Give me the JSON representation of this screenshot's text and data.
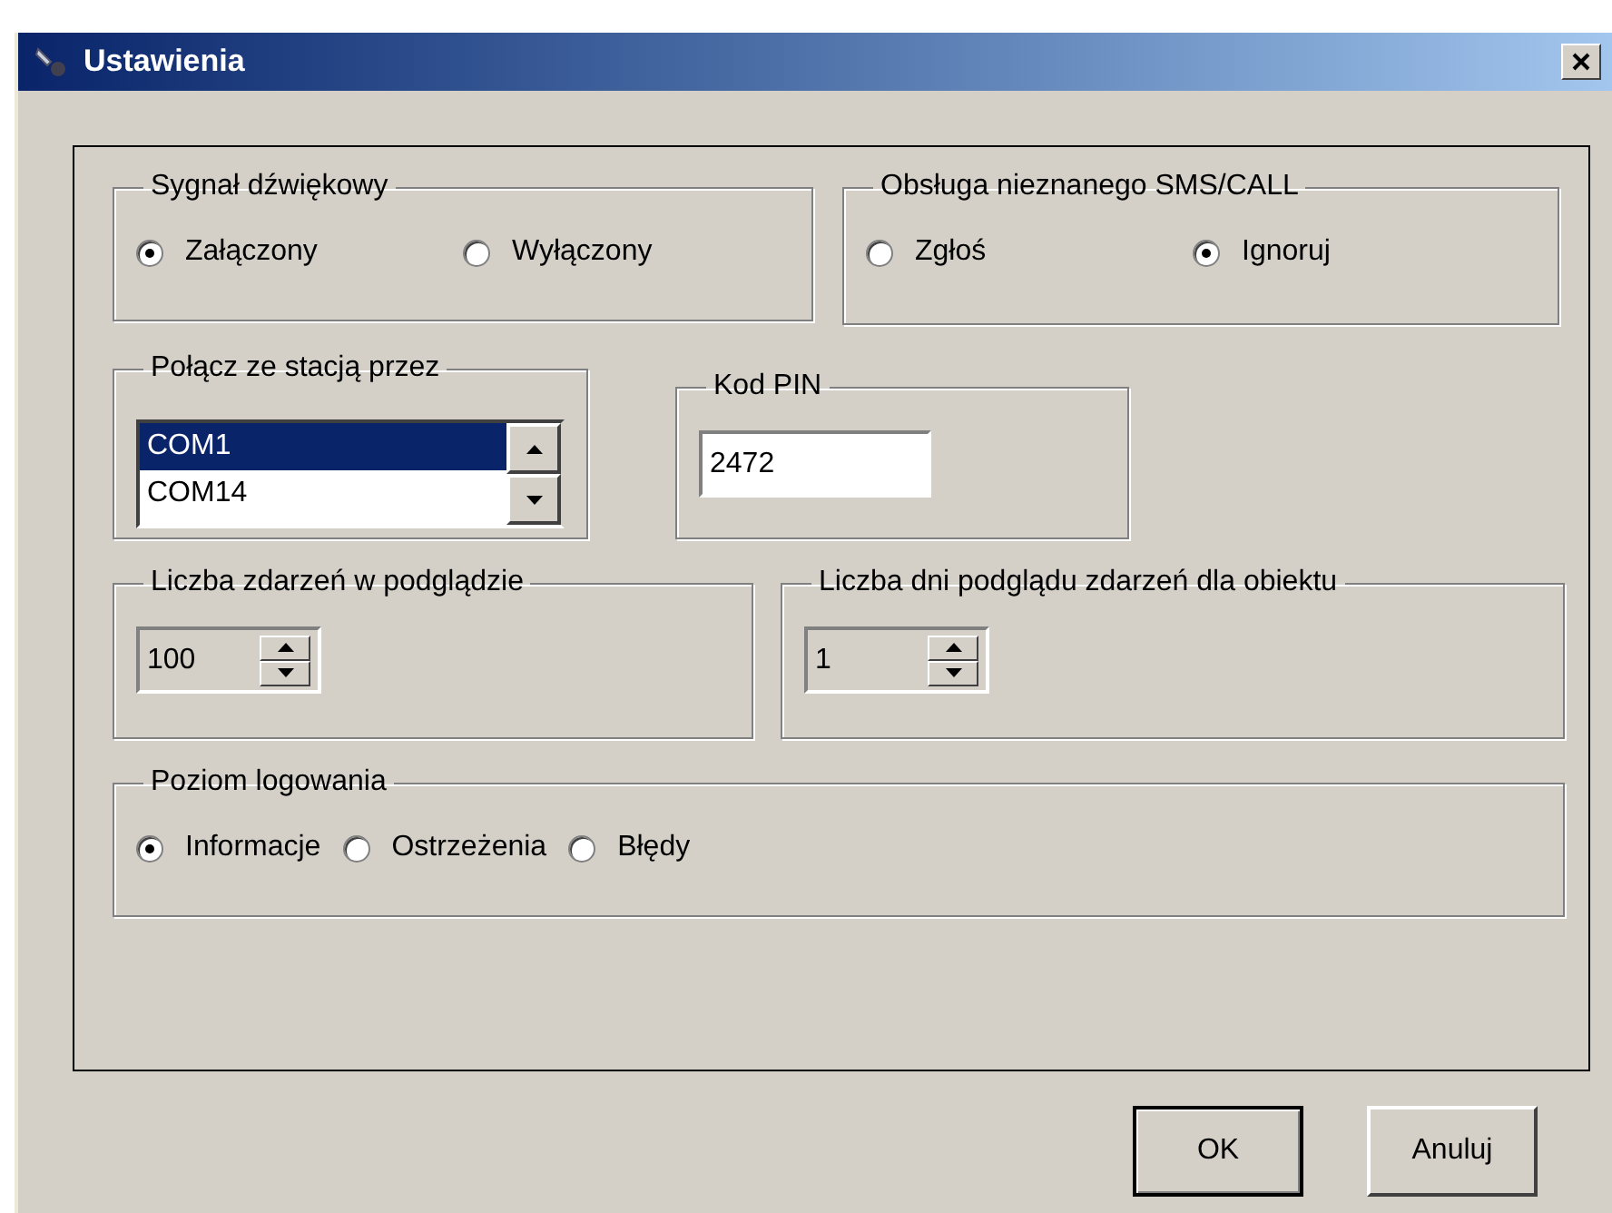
{
  "window": {
    "title": "Ustawienia"
  },
  "sound": {
    "title": "Sygnał dźwiękowy",
    "options": [
      {
        "label": "Załączony",
        "selected": true
      },
      {
        "label": "Wyłączony",
        "selected": false
      }
    ]
  },
  "unknown_sms_call": {
    "title": "Obsługa nieznanego SMS/CALL",
    "options": [
      {
        "label": "Zgłoś",
        "selected": false
      },
      {
        "label": "Ignoruj",
        "selected": true
      }
    ]
  },
  "connection": {
    "title": "Połącz ze stacją przez",
    "items": [
      {
        "label": "COM1",
        "selected": true
      },
      {
        "label": "COM14",
        "selected": false
      }
    ]
  },
  "pin": {
    "title": "Kod PIN",
    "value": "2472"
  },
  "events_count": {
    "title": "Liczba zdarzeń w podglądzie",
    "value": "100"
  },
  "days_count": {
    "title": "Liczba dni podglądu zdarzeń dla obiektu",
    "value": "1"
  },
  "logging": {
    "title": "Poziom logowania",
    "options": [
      {
        "label": "Informacje",
        "selected": true
      },
      {
        "label": "Ostrzeżenia",
        "selected": false
      },
      {
        "label": "Błędy",
        "selected": false
      }
    ]
  },
  "buttons": [
    {
      "label": "OK",
      "default": true
    },
    {
      "label": "Anuluj",
      "default": false
    }
  ]
}
